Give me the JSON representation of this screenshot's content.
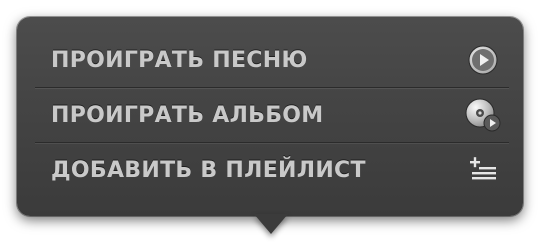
{
  "popover": {
    "menu": {
      "items": [
        {
          "label": "ПРОИГРАТЬ ПЕСНЮ",
          "icon": "play-circle-icon"
        },
        {
          "label": "ПРОИГРАТЬ АЛЬБОМ",
          "icon": "album-disc-play-icon"
        },
        {
          "label": "ДОБАВИТЬ В ПЛЕЙЛИСТ",
          "icon": "add-to-playlist-icon"
        }
      ]
    }
  }
}
